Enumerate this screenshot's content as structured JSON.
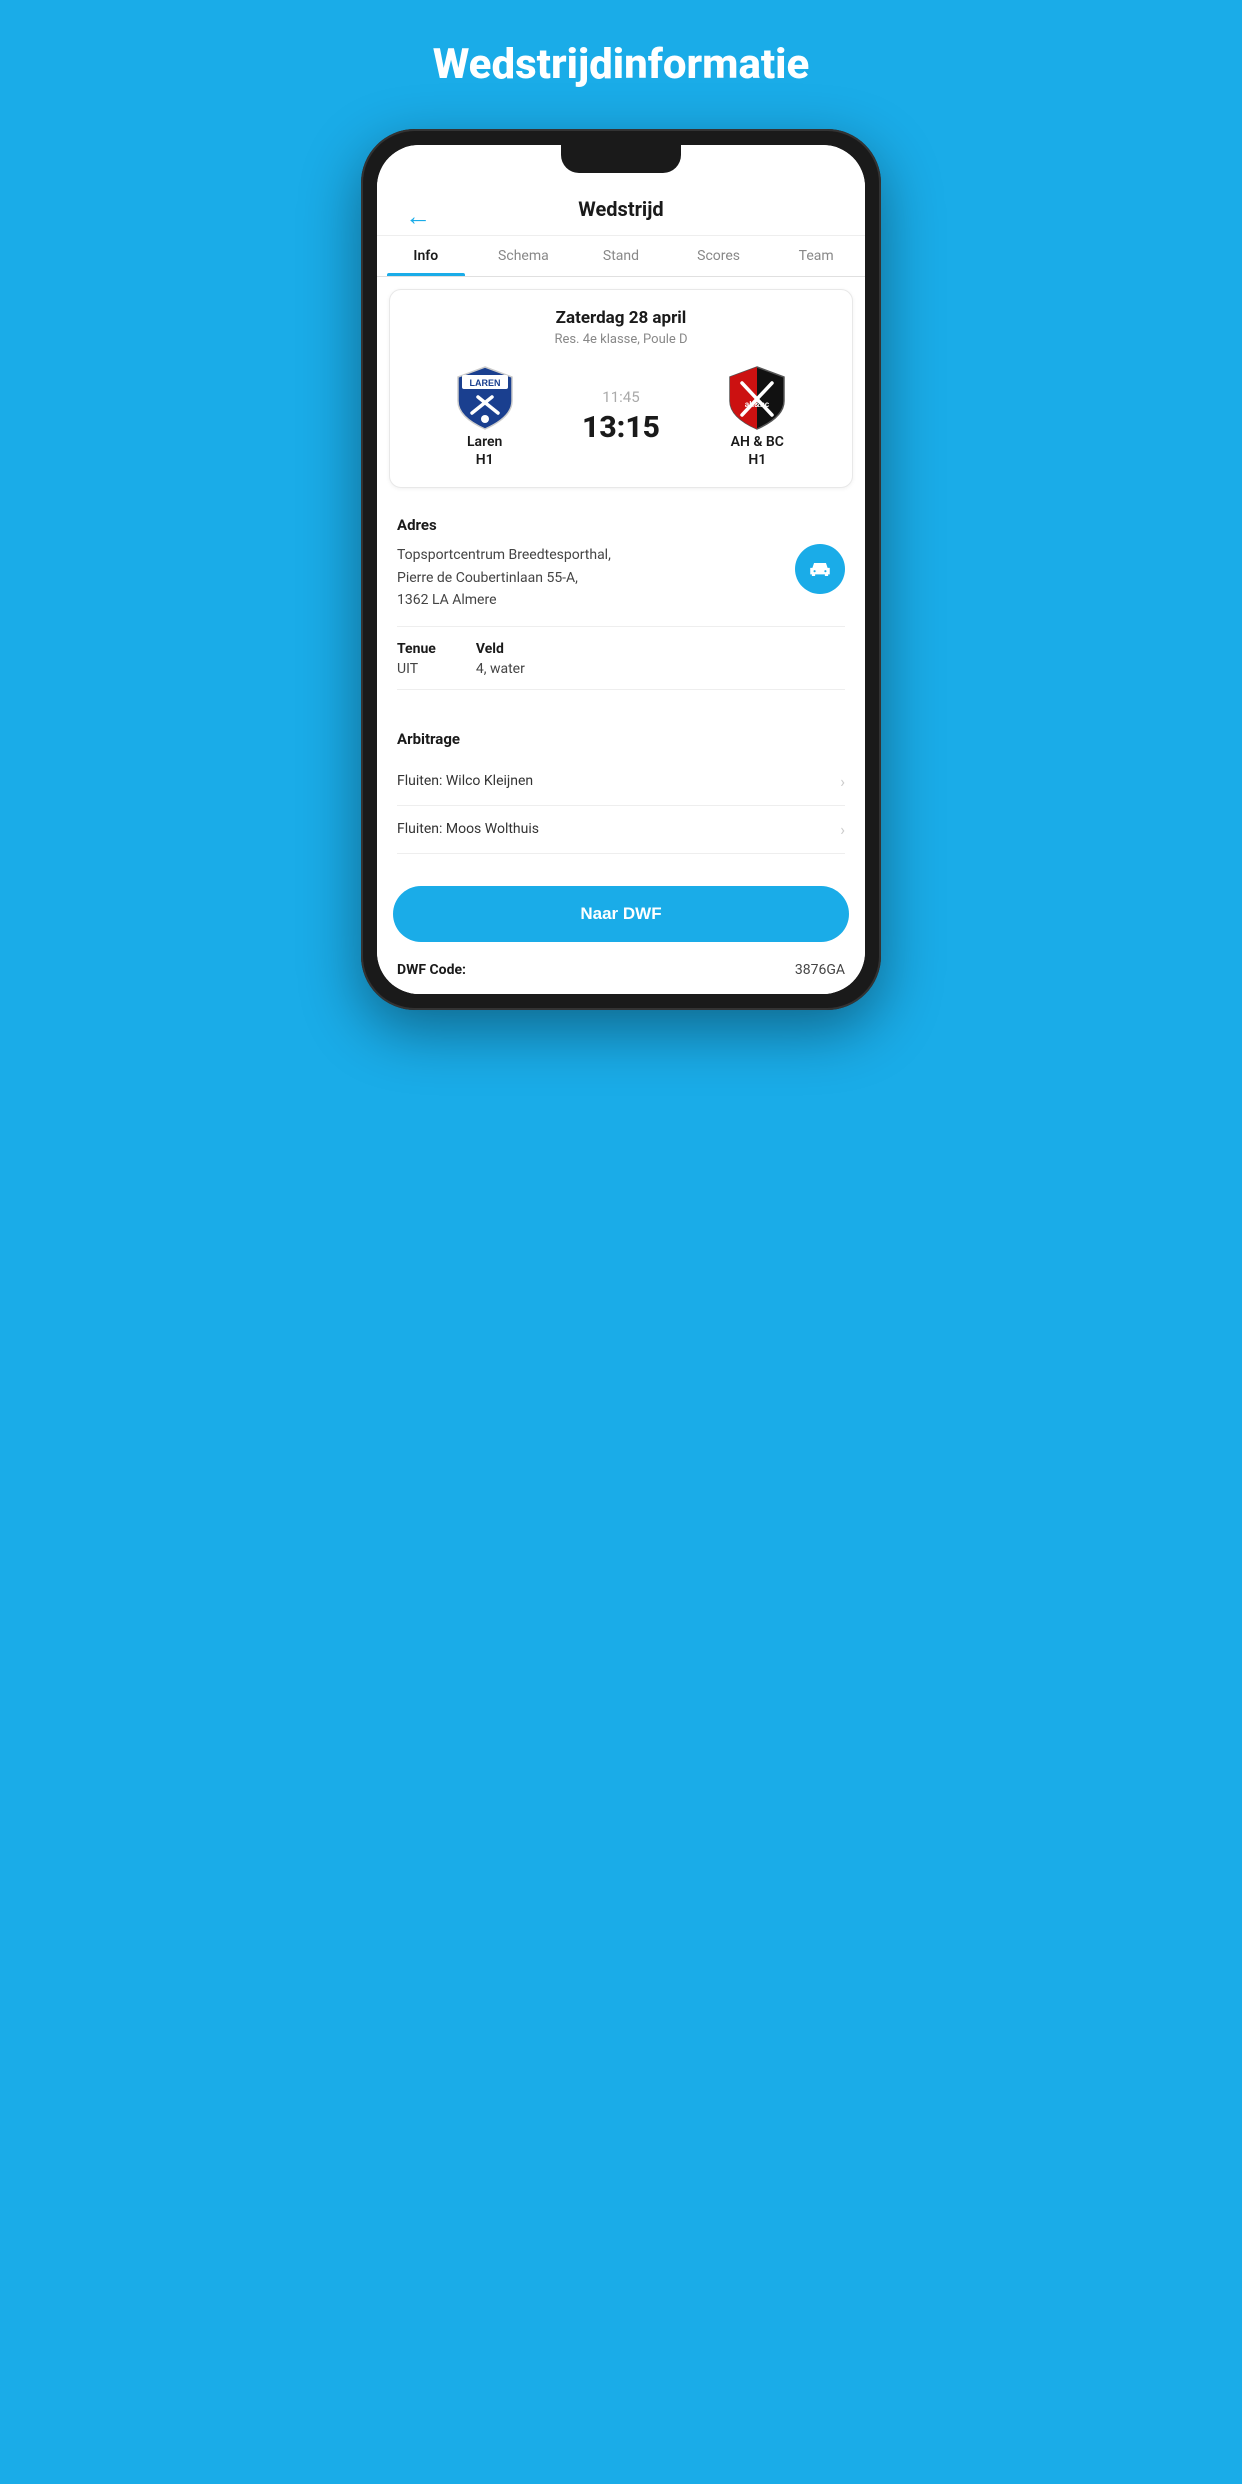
{
  "page": {
    "background_title": "Wedstrijdinformatie"
  },
  "header": {
    "title": "Wedstrijd",
    "back_label": "←"
  },
  "tabs": [
    {
      "id": "info",
      "label": "Info",
      "active": true
    },
    {
      "id": "schema",
      "label": "Schema",
      "active": false
    },
    {
      "id": "stand",
      "label": "Stand",
      "active": false
    },
    {
      "id": "scores",
      "label": "Scores",
      "active": false
    },
    {
      "id": "team",
      "label": "Team",
      "active": false
    }
  ],
  "match": {
    "date": "Zaterdag 28 april",
    "competition": "Res. 4e klasse, Poule D",
    "home_team_name": "Laren",
    "home_team_sub": "H1",
    "away_team_name": "AH & BC",
    "away_team_sub": "H1",
    "score_time": "11:45",
    "score_main": "13:15"
  },
  "info": {
    "address_label": "Adres",
    "address_text": "Topsportcentrum Breedtesporthal,\nPierre de Coubertinlaan 55-A,\n1362 LA Almere",
    "tenue_label": "Tenue",
    "tenue_value": "UIT",
    "veld_label": "Veld",
    "veld_value": "4, water"
  },
  "arbitrage": {
    "title": "Arbitrage",
    "items": [
      {
        "label": "Fluiten: Wilco Kleijnen"
      },
      {
        "label": "Fluiten: Moos Wolthuis"
      }
    ]
  },
  "dwf": {
    "button_label": "Naar DWF",
    "code_label": "DWF Code:",
    "code_value": "3876GA"
  },
  "colors": {
    "primary": "#1AACE8",
    "background": "#1AACE8"
  }
}
